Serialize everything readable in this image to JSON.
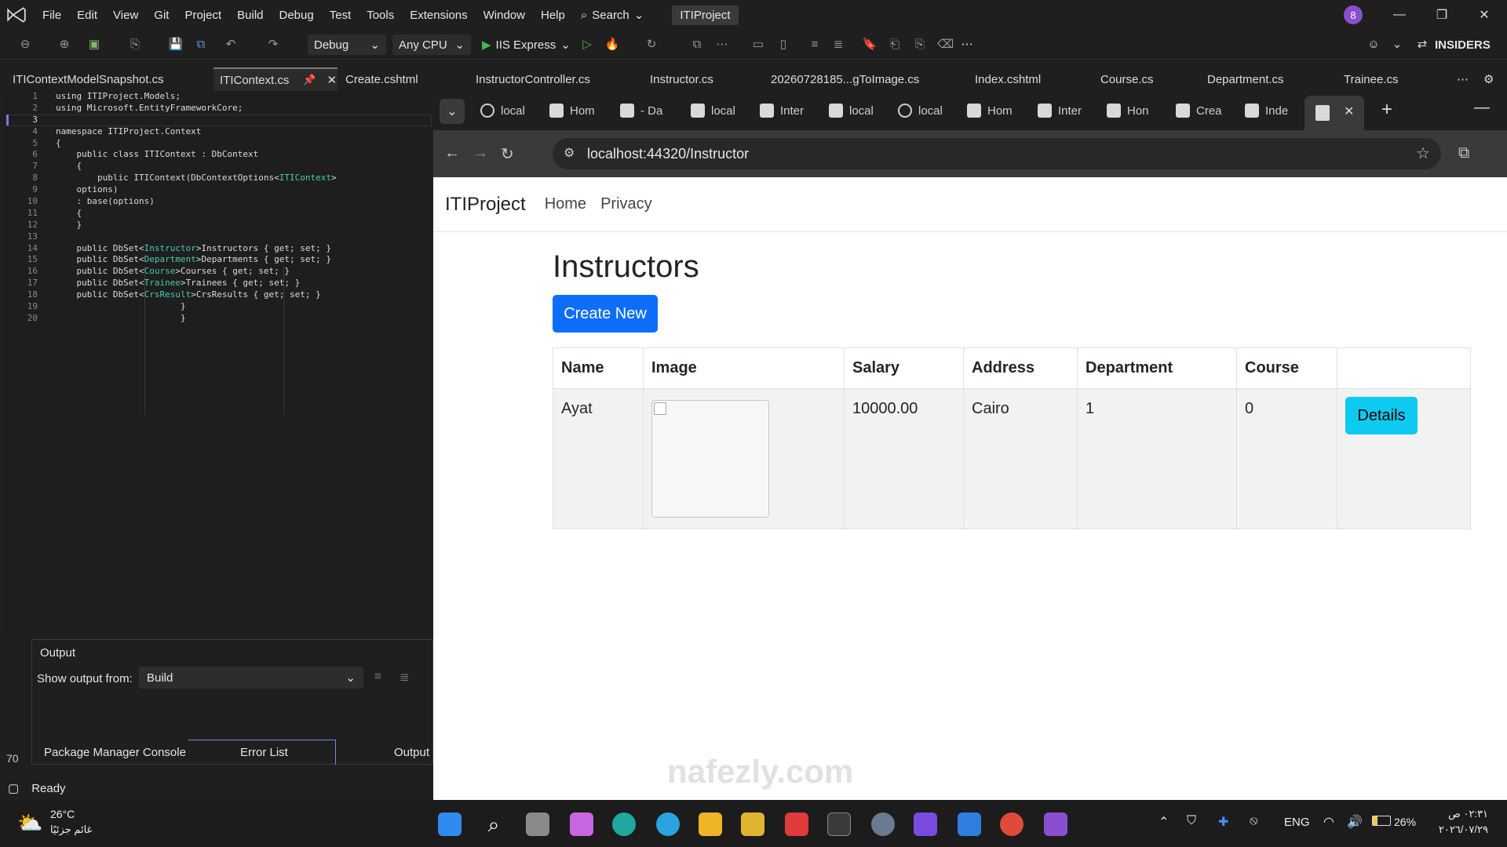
{
  "vs": {
    "menu": [
      "File",
      "Edit",
      "View",
      "Git",
      "Project",
      "Build",
      "Debug",
      "Test",
      "Tools",
      "Extensions",
      "Window",
      "Help"
    ],
    "search_label": "Search",
    "project_title": "ITIProject",
    "notification_count": "8",
    "toolbar": {
      "config": "Debug",
      "platform": "Any CPU",
      "run_target": "IIS Express",
      "insiders": "INSIDERS"
    },
    "doc_tabs": [
      "ITIContextModelSnapshot.cs",
      "ITIContext.cs",
      "Create.cshtml",
      "InstructorController.cs",
      "Instructor.cs",
      "20260728185...gToImage.cs",
      "Index.cshtml",
      "Course.cs",
      "Department.cs",
      "Trainee.cs"
    ],
    "active_tab": "ITIContext.cs",
    "line_numbers": [
      "1",
      "2",
      "3",
      "4",
      "5",
      "6",
      "7",
      "8",
      "9",
      "10",
      "11",
      "12",
      "13",
      "14",
      "15",
      "16",
      "17",
      "18",
      "19",
      "20"
    ],
    "code": {
      "l1": "using ITIProject.Models;",
      "l2": "using Microsoft.EntityFrameworkCore;",
      "l4": "namespace ITIProject.Context",
      "l5": "{",
      "l6": "    public class ITIContext : DbContext",
      "l7": "    {",
      "l8a": "        public ITIContext(DbContextOptions<",
      "l8b": "ITIContext",
      "l8c": ">",
      "l9": "    options)",
      "l10": "    : base(options)",
      "l11": "    {",
      "l12": "    }",
      "l14a": "    public DbSet<",
      "l14b": "Instructor",
      "l14c": ">Instructors { get; set; }",
      "l15a": "    public DbSet<",
      "l15b": "Department",
      "l15c": ">Departments { get; set; }",
      "l16a": "    public DbSet<",
      "l16b": "Course",
      "l16c": ">Courses { get; set; }",
      "l17a": "    public DbSet<",
      "l17b": "Trainee",
      "l17c": ">Trainees { get; set; }",
      "l18a": "    public DbSet<",
      "l18b": "CrsResult",
      "l18c": ">CrsResults { get; set; }",
      "l19": "                        }",
      "l20": "                        }"
    },
    "output": {
      "title": "Output",
      "show_from_label": "Show output from:",
      "show_from_value": "Build"
    },
    "bottom_tabs": [
      "Package Manager Console",
      "Error List",
      "Output"
    ],
    "zoom": "70",
    "status": "Ready"
  },
  "browser": {
    "tabs": [
      "local",
      "Hom",
      "- Da",
      "local",
      "Inter",
      "local",
      "local",
      "Hom",
      "Inter",
      "Hon",
      "Crea",
      "Inde"
    ],
    "url": "localhost:44320/Instructor"
  },
  "web": {
    "brand": "ITIProject",
    "nav": [
      "Home",
      "Privacy"
    ],
    "page_title": "Instructors",
    "create_label": "Create New",
    "columns": [
      "Name",
      "Image",
      "Salary",
      "Address",
      "Department",
      "Course",
      ""
    ],
    "rows": [
      {
        "name": "Ayat",
        "salary": "10000.00",
        "address": "Cairo",
        "department": "1",
        "course": "0",
        "action": "Details"
      }
    ]
  },
  "taskbar": {
    "temperature": "26°C",
    "weather": "غائم جزئيًا",
    "lang": "ENG",
    "battery": "26%",
    "time": "٠٢:٣١ ص",
    "date": "٢٠٢٦/٠٧/٢٩"
  },
  "watermark": "nafezly.com",
  "colors": {
    "primary": "#0d6efd",
    "info": "#0dcaf0",
    "type": "#4ec9b0",
    "badge": "#8a4fd1"
  }
}
